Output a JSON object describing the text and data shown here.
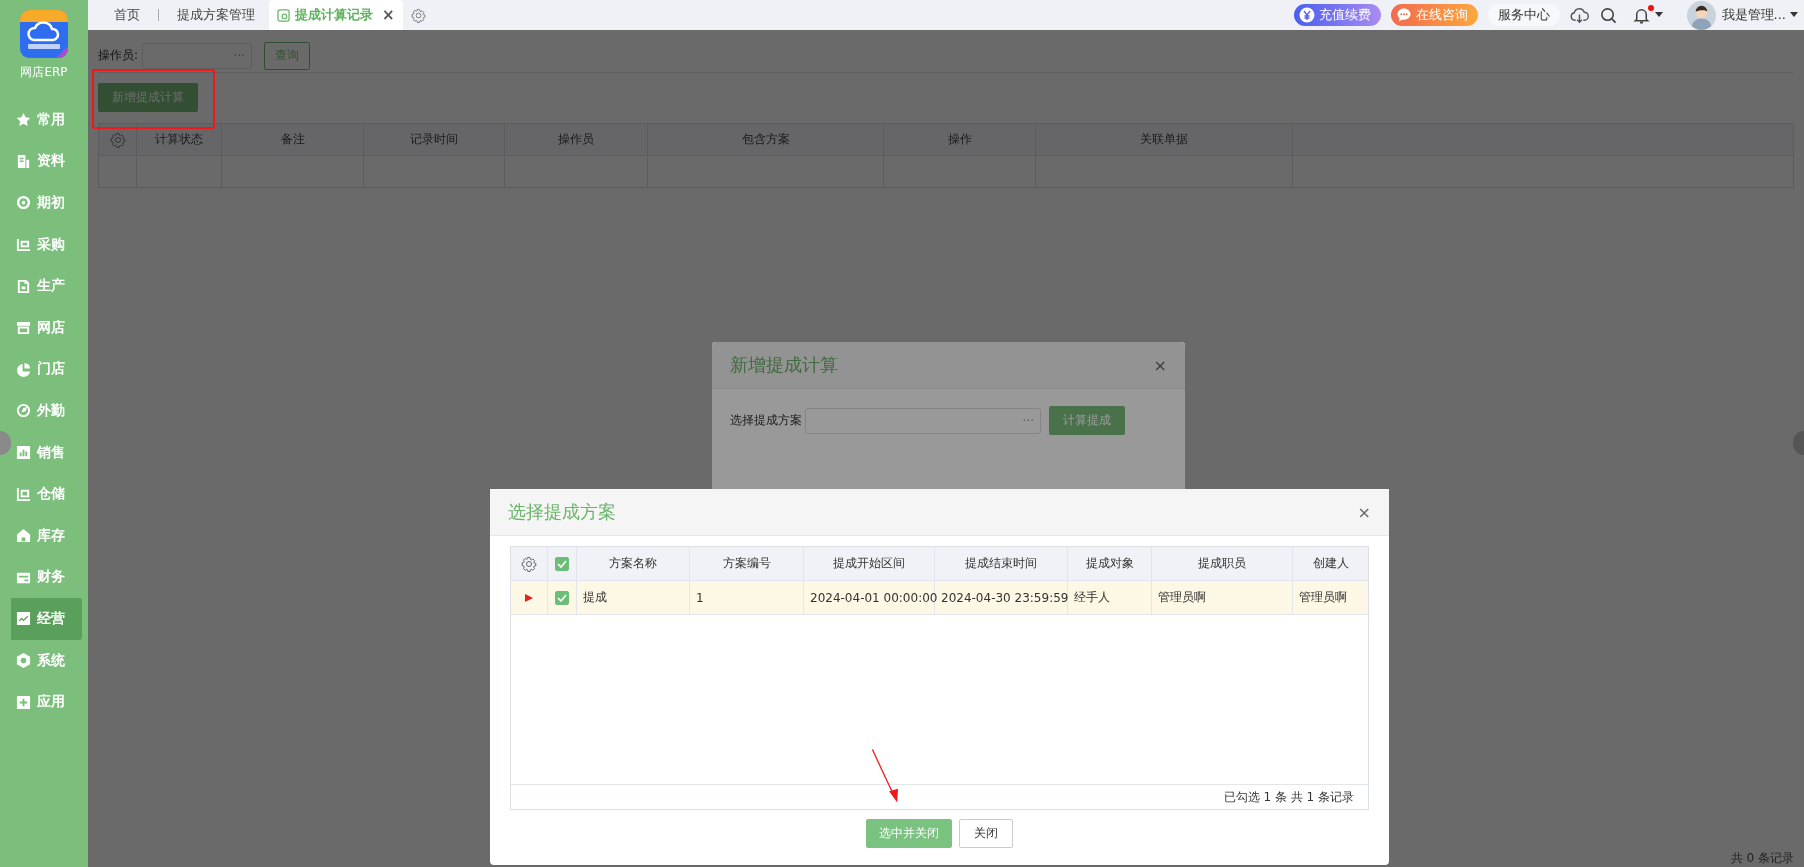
{
  "sidebar": {
    "brand": "网店ERP",
    "items": [
      {
        "label": "常用",
        "selected": false
      },
      {
        "label": "资料",
        "selected": false
      },
      {
        "label": "期初",
        "selected": false
      },
      {
        "label": "采购",
        "selected": false
      },
      {
        "label": "生产",
        "selected": false
      },
      {
        "label": "网店",
        "selected": false
      },
      {
        "label": "门店",
        "selected": false
      },
      {
        "label": "外勤",
        "selected": false
      },
      {
        "label": "销售",
        "selected": false
      },
      {
        "label": "仓储",
        "selected": false
      },
      {
        "label": "库存",
        "selected": false
      },
      {
        "label": "财务",
        "selected": false
      },
      {
        "label": "经营",
        "selected": true
      },
      {
        "label": "系统",
        "selected": false
      },
      {
        "label": "应用",
        "selected": false
      }
    ]
  },
  "tabs": [
    {
      "label": "首页",
      "selected": false
    },
    {
      "label": "提成方案管理",
      "selected": false
    },
    {
      "label": "提成计算记录",
      "selected": true,
      "close": "×"
    }
  ],
  "header": {
    "recharge": "充值续费",
    "consult": "在线咨询",
    "service": "服务中心",
    "has_notification": true,
    "user": "我是管理..."
  },
  "page": {
    "operator_label": "操作员:",
    "field_more": "···",
    "query_button": "查询",
    "add_button": "新增提成计算",
    "columns": [
      "计算状态",
      "备注",
      "记录时间",
      "操作员",
      "包含方案",
      "操作",
      "关联单据"
    ],
    "total": "共 0 条记录"
  },
  "dialog_new": {
    "title": "新增提成计算",
    "close": "×",
    "label": "选择提成方案",
    "field_more": "···",
    "button": "计算提成"
  },
  "dialog_select": {
    "title": "选择提成方案",
    "close": "×",
    "all_checked": true,
    "columns": [
      "方案名称",
      "方案编号",
      "提成开始区间",
      "提成结束时间",
      "提成对象",
      "提成职员",
      "创建人"
    ],
    "rows": [
      {
        "current": true,
        "checked": true,
        "cells": [
          "提成",
          "1",
          "2024-04-01 00:00:00",
          "2024-04-30 23:59:59",
          "经手人",
          "管理员啊",
          "管理员啊"
        ]
      }
    ],
    "summary": "已勾选 1 条 共 1 条记录",
    "buttons": [
      {
        "label": "选中并关闭",
        "kind": "primary"
      },
      {
        "label": "关闭",
        "kind": "default"
      }
    ]
  }
}
